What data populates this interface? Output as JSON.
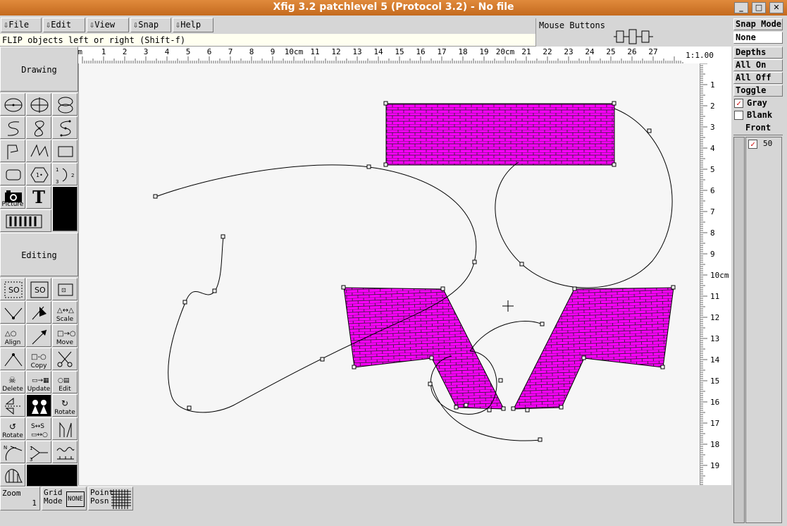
{
  "window": {
    "title": "Xfig 3.2 patchlevel 5 (Protocol 3.2) - No file"
  },
  "menu": {
    "items": [
      "File",
      "Edit",
      "View",
      "Snap",
      "Help"
    ]
  },
  "message": "FLIP objects left or right   (Shift-f)",
  "mouse_buttons_label": "Mouse Buttons",
  "zoom_ratio": "1:1.00",
  "top_ruler": {
    "labels": [
      "cm",
      "1",
      "2",
      "3",
      "4",
      "5",
      "6",
      "7",
      "8",
      "9",
      "10cm",
      "11",
      "12",
      "13",
      "14",
      "15",
      "16",
      "17",
      "18",
      "19",
      "20cm",
      "21",
      "22",
      "23",
      "24",
      "25",
      "26",
      "27"
    ]
  },
  "side_ruler": {
    "labels": [
      "1",
      "2",
      "3",
      "4",
      "5",
      "6",
      "7",
      "8",
      "9",
      "10cm",
      "11",
      "12",
      "13",
      "14",
      "15",
      "16",
      "17",
      "18",
      "19"
    ]
  },
  "sections": {
    "drawing": "Drawing",
    "editing": "Editing"
  },
  "tools": {
    "picture": "Picture",
    "text": "T",
    "scale": "Scale",
    "align": "Align",
    "move": "Move",
    "copy": "Copy",
    "delete": "Delete",
    "update": "Update",
    "edit": "Edit",
    "rotate1": "Rotate",
    "rotate2": "Rotate"
  },
  "bottom": {
    "zoom_label": "Zoom",
    "zoom_value": "1",
    "grid_label": "Grid",
    "grid_label2": "Mode",
    "grid_value": "NONE",
    "point_label": "Point",
    "point_label2": "Posn"
  },
  "right_panel": {
    "snap_mode": "Snap Mode",
    "snap_value": "None",
    "depths": "Depths",
    "all_on": "All On",
    "all_off": "All Off",
    "toggle": "Toggle",
    "gray": "Gray",
    "blank": "Blank",
    "front": "Front",
    "depth_value": "50"
  },
  "colors": {
    "fill": "#ff00ff",
    "brick": "#222222",
    "title_bar": "#d27a2c"
  }
}
